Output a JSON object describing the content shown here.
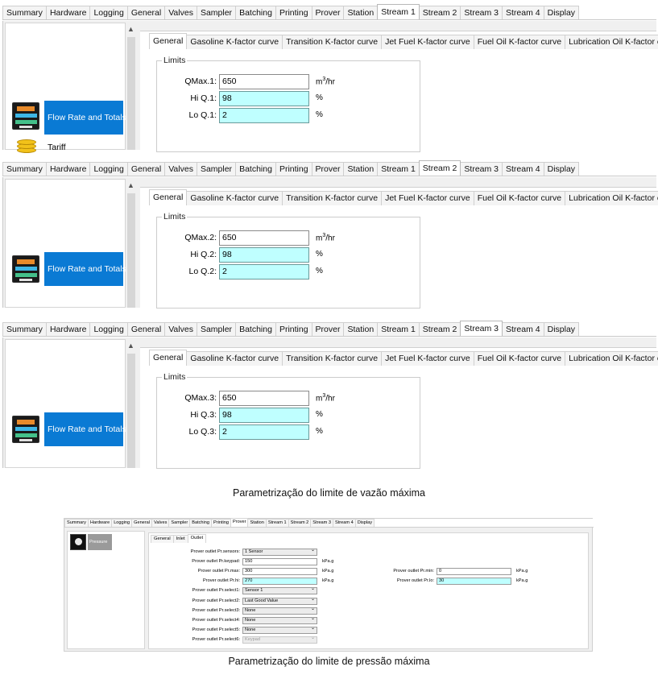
{
  "main_tabs": [
    "Summary",
    "Hardware",
    "Logging",
    "General",
    "Valves",
    "Sampler",
    "Batching",
    "Printing",
    "Prover",
    "Station",
    "Stream 1",
    "Stream 2",
    "Stream 3",
    "Stream 4",
    "Display"
  ],
  "sub_tabs": [
    "General",
    "Gasoline K-factor curve",
    "Transition K-factor curve",
    "Jet Fuel K-factor curve",
    "Fuel Oil K-factor curve",
    "Lubrication Oil K-factor curve"
  ],
  "group_title": "Limits",
  "panels": [
    {
      "active_tab": "Stream 1",
      "list_items": [
        {
          "label": "Flow Rate and Totals",
          "selected": true
        },
        {
          "label": "Tariff",
          "selected": false
        }
      ],
      "fields": [
        {
          "label": "QMax.1:",
          "value": "650",
          "unit_base": "m",
          "unit_sup": "3",
          "unit_tail": "/hr",
          "cyan": false
        },
        {
          "label": "Hi Q.1:",
          "value": "98",
          "unit": "%",
          "cyan": true
        },
        {
          "label": "Lo Q.1:",
          "value": "2",
          "unit": "%",
          "cyan": true
        }
      ]
    },
    {
      "active_tab": "Stream 2",
      "list_items": [
        {
          "label": "Flow Rate and Totals",
          "selected": true
        }
      ],
      "fields": [
        {
          "label": "QMax.2:",
          "value": "650",
          "unit_base": "m",
          "unit_sup": "3",
          "unit_tail": "/hr",
          "cyan": false
        },
        {
          "label": "Hi Q.2:",
          "value": "98",
          "unit": "%",
          "cyan": true
        },
        {
          "label": "Lo Q.2:",
          "value": "2",
          "unit": "%",
          "cyan": true
        }
      ]
    },
    {
      "active_tab": "Stream 3",
      "list_items": [
        {
          "label": "Flow Rate and Totals",
          "selected": true
        }
      ],
      "fields": [
        {
          "label": "QMax.3:",
          "value": "650",
          "unit_base": "m",
          "unit_sup": "3",
          "unit_tail": "/hr",
          "cyan": false
        },
        {
          "label": "Hi Q.3:",
          "value": "98",
          "unit": "%",
          "cyan": true
        },
        {
          "label": "Lo Q.3:",
          "value": "2",
          "unit": "%",
          "cyan": true
        }
      ]
    }
  ],
  "caption_flow": "Parametrização do limite de vazão máxima",
  "caption_pressure": "Parametrização do limite de pressão máxima",
  "mini": {
    "tabs": [
      "Summary",
      "Hardware",
      "Logging",
      "General",
      "Valves",
      "Sampler",
      "Batching",
      "Printing",
      "Prover",
      "Station",
      "Stream 1",
      "Stream 2",
      "Stream 3",
      "Stream 4",
      "Display"
    ],
    "active_tab": "Prover",
    "list_item": "Pressure",
    "sub_tabs": [
      "General",
      "Inlet",
      "Outlet"
    ],
    "active_sub_tab": "Outlet",
    "rows": [
      {
        "label": "Prover outlet Pr.sensors:",
        "value": "1 Sensor",
        "kind": "combo"
      },
      {
        "label": "Prover outlet Pr.keypad:",
        "value": "150",
        "kind": "text",
        "unit": "kPa.g"
      },
      {
        "label": "Prover outlet Pr.max:",
        "value": "300",
        "kind": "text",
        "unit": "kPa.g"
      },
      {
        "label": "Prover outlet Pr.hi:",
        "value": "270",
        "kind": "cyan",
        "unit": "kPa.g"
      },
      {
        "label": "Prover outlet Pr.select1:",
        "value": "Sensor 1",
        "kind": "combo"
      },
      {
        "label": "Prover outlet Pr.select2:",
        "value": "Last Good Value",
        "kind": "combo"
      },
      {
        "label": "Prover outlet Pr.select3:",
        "value": "None",
        "kind": "combo"
      },
      {
        "label": "Prover outlet Pr.select4:",
        "value": "None",
        "kind": "combo"
      },
      {
        "label": "Prover outlet Pr.select5:",
        "value": "None",
        "kind": "combo"
      },
      {
        "label": "Prover outlet Pr.select6:",
        "value": "Keypad",
        "kind": "disabled"
      }
    ],
    "right_rows": [
      {
        "label": "Prover outlet Pr.min:",
        "value": "0",
        "kind": "text",
        "unit": "kPa.g"
      },
      {
        "label": "Prover outlet Pr.lo:",
        "value": "30",
        "kind": "cyan",
        "unit": "kPa.g"
      }
    ]
  }
}
